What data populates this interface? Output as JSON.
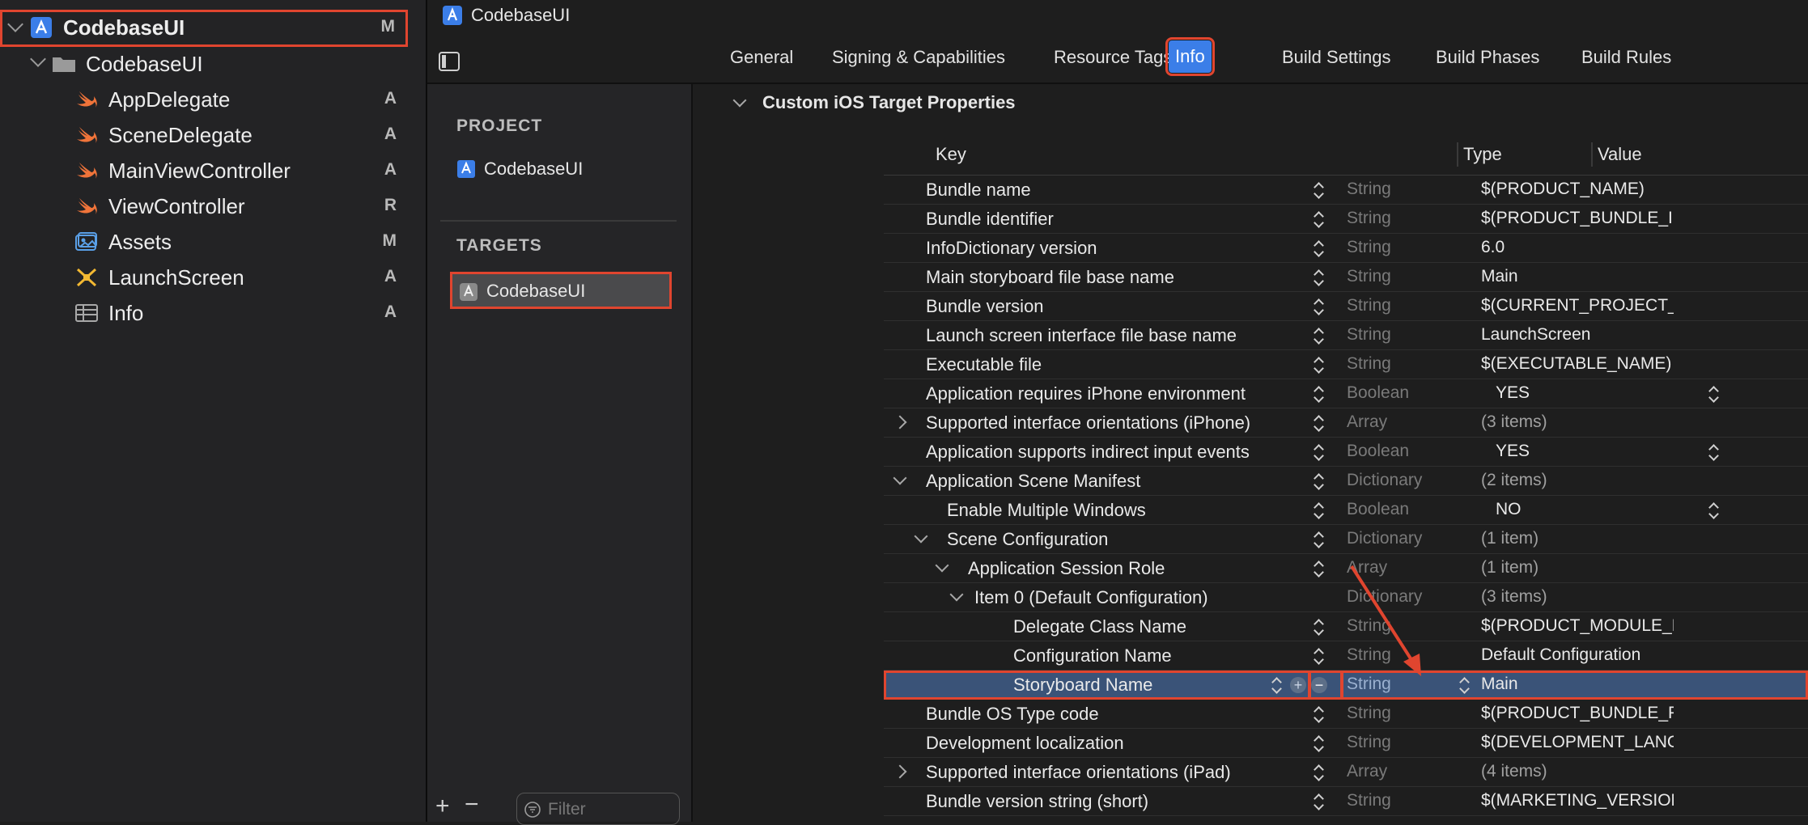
{
  "navigator": {
    "project": {
      "label": "CodebaseUI",
      "badge": "M"
    },
    "group": {
      "label": "CodebaseUI"
    },
    "files": [
      {
        "label": "AppDelegate",
        "badge": "A",
        "icon": "swift-icon"
      },
      {
        "label": "SceneDelegate",
        "badge": "A",
        "icon": "swift-icon"
      },
      {
        "label": "MainViewController",
        "badge": "A",
        "icon": "swift-icon"
      },
      {
        "label": "ViewController",
        "badge": "R",
        "icon": "swift-icon"
      },
      {
        "label": "Assets",
        "badge": "M",
        "icon": "asset-catalog-icon"
      },
      {
        "label": "LaunchScreen",
        "badge": "A",
        "icon": "storyboard-icon"
      },
      {
        "label": "Info",
        "badge": "A",
        "icon": "plist-icon"
      }
    ]
  },
  "editor": {
    "title": "CodebaseUI",
    "tabs": [
      "General",
      "Signing & Capabilities",
      "Resource Tags",
      "Info",
      "Build Settings",
      "Build Phases",
      "Build Rules"
    ],
    "active_tab": "Info"
  },
  "targets_panel": {
    "project_header": "PROJECT",
    "project_item": "CodebaseUI",
    "targets_header": "TARGETS",
    "target_item": "CodebaseUI",
    "filter_placeholder": "Filter"
  },
  "properties": {
    "section_title": "Custom iOS Target Properties",
    "columns": {
      "key": "Key",
      "type": "Type",
      "value": "Value"
    },
    "rows": [
      {
        "key": "Bundle name",
        "type": "String",
        "value": "$(PRODUCT_NAME)"
      },
      {
        "key": "Bundle identifier",
        "type": "String",
        "value": "$(PRODUCT_BUNDLE_IDENTIFIER)"
      },
      {
        "key": "InfoDictionary version",
        "type": "String",
        "value": "6.0"
      },
      {
        "key": "Main storyboard file base name",
        "type": "String",
        "value": "Main"
      },
      {
        "key": "Bundle version",
        "type": "String",
        "value": "$(CURRENT_PROJECT_VERSION)"
      },
      {
        "key": "Launch screen interface file base name",
        "type": "String",
        "value": "LaunchScreen"
      },
      {
        "key": "Executable file",
        "type": "String",
        "value": "$(EXECUTABLE_NAME)"
      },
      {
        "key": "Application requires iPhone environment",
        "type": "Boolean",
        "value": "YES"
      },
      {
        "key": "Supported interface orientations (iPhone)",
        "type": "Array",
        "value": "(3 items)"
      },
      {
        "key": "Application supports indirect input events",
        "type": "Boolean",
        "value": "YES"
      },
      {
        "key": "Application Scene Manifest",
        "type": "Dictionary",
        "value": "(2 items)"
      },
      {
        "key": "Enable Multiple Windows",
        "type": "Boolean",
        "value": "NO"
      },
      {
        "key": "Scene Configuration",
        "type": "Dictionary",
        "value": "(1 item)"
      },
      {
        "key": "Application Session Role",
        "type": "Array",
        "value": "(1 item)"
      },
      {
        "key": "Item 0 (Default Configuration)",
        "type": "Dictionary",
        "value": "(3 items)"
      },
      {
        "key": "Delegate Class Name",
        "type": "String",
        "value": "$(PRODUCT_MODULE_NAME).SceneDelegate"
      },
      {
        "key": "Configuration Name",
        "type": "String",
        "value": "Default Configuration"
      },
      {
        "key": "Storyboard Name",
        "type": "String",
        "value": "Main"
      },
      {
        "key": "Bundle OS Type code",
        "type": "String",
        "value": "$(PRODUCT_BUNDLE_PACKAGE_TYPE)"
      },
      {
        "key": "Development localization",
        "type": "String",
        "value": "$(DEVELOPMENT_LANGUAGE)"
      },
      {
        "key": "Supported interface orientations (iPad)",
        "type": "Array",
        "value": "(4 items)"
      },
      {
        "key": "Bundle version string (short)",
        "type": "String",
        "value": "$(MARKETING_VERSION)"
      }
    ]
  },
  "colors": {
    "highlight": "#e0452f",
    "selection": "#3a5378",
    "swift": "#f0743a",
    "accent": "#3b7ee8"
  }
}
